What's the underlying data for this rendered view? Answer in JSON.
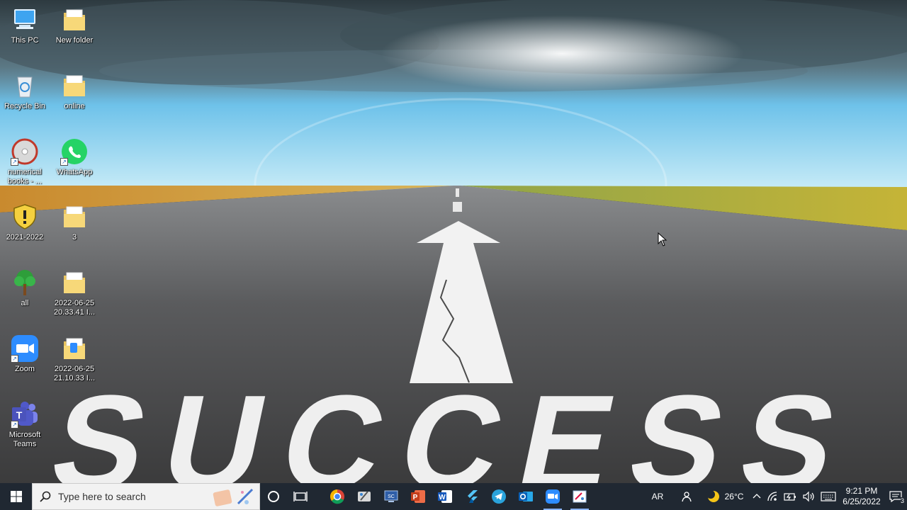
{
  "desktop": {
    "icons": [
      {
        "label": "This PC",
        "icon": "this-pc-icon"
      },
      {
        "label": "New folder",
        "icon": "folder-icon"
      },
      {
        "label": "Recycle Bin",
        "icon": "recycle-bin-icon"
      },
      {
        "label": "online",
        "icon": "folder-icon"
      },
      {
        "label": "numerical books - ...",
        "icon": "disc-shortcut-icon"
      },
      {
        "label": "WhatsApp",
        "icon": "whatsapp-icon"
      },
      {
        "label": "2021-2022",
        "icon": "shield-warning-icon"
      },
      {
        "label": "3",
        "icon": "folder-icon"
      },
      {
        "label": "all",
        "icon": "tree-icon"
      },
      {
        "label": "2022-06-25 20.33.41 I...",
        "icon": "folder-icon"
      },
      {
        "label": "Zoom",
        "icon": "zoom-icon"
      },
      {
        "label": "2022-06-25 21.10.33 I...",
        "icon": "folder-icon"
      },
      {
        "label": "Microsoft Teams",
        "icon": "teams-icon"
      }
    ],
    "wallpaper_text": "SUCCESS"
  },
  "taskbar": {
    "search_placeholder": "Type here to search",
    "apps": [
      "cortana-icon",
      "task-view-icon",
      "chrome-icon",
      "paint-brush-app-icon",
      "screen-capture-app-icon",
      "powerpoint-icon",
      "word-icon",
      "flutter-app-icon",
      "telegram-icon",
      "outlook-icon",
      "zoom-icon",
      "paint-icon"
    ],
    "language": "AR",
    "weather": "26°C",
    "time": "9:21 PM",
    "date": "6/25/2022",
    "notifications": "3"
  },
  "colors": {
    "taskbar": "#202832",
    "sky": "#5fb7e8",
    "road": "#4a4a4a",
    "field": "#c9a23a"
  }
}
